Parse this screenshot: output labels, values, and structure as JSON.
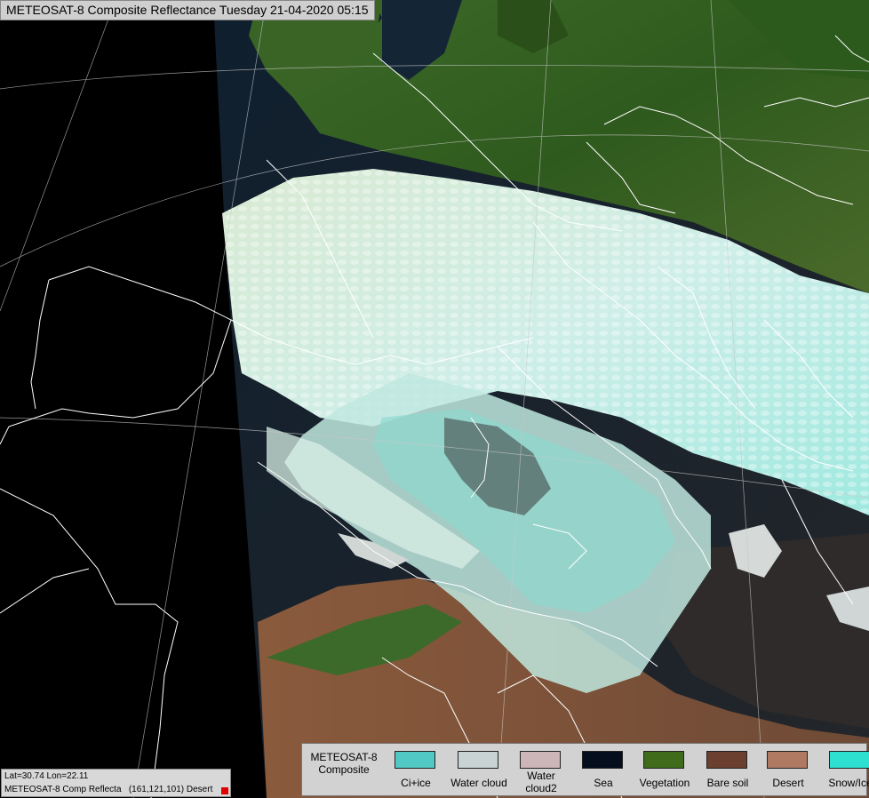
{
  "title": "METEOSAT-8 Composite Reflectance Tuesday 21-04-2020 05:15",
  "legend": {
    "name": "METEOSAT-8\nComposite",
    "items": [
      {
        "label": "Ci+ice",
        "color": "#52c8c5"
      },
      {
        "label": "Water cloud",
        "color": "#c9d3d3"
      },
      {
        "label": "Water\ncloud2",
        "color": "#cdb6b8"
      },
      {
        "label": "Sea",
        "color": "#040e1c"
      },
      {
        "label": "Vegetation",
        "color": "#3f6b1a"
      },
      {
        "label": "Bare soil",
        "color": "#6b4030"
      },
      {
        "label": "Desert",
        "color": "#b07a62"
      },
      {
        "label": "Snow/Ice",
        "color": "#2ee0cf"
      }
    ]
  },
  "status": {
    "coords": "Lat=30.74 Lon=22.11",
    "product": "METEOSAT-8 Comp Reflecta   (161,121,101) Desert"
  }
}
